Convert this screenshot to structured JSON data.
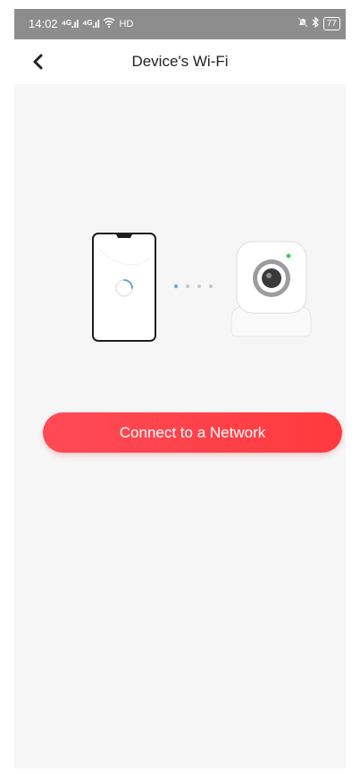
{
  "status_bar": {
    "time": "14:02",
    "signal_1": "⁴ᴳ.ıl",
    "signal_2": "⁴ᴳ.ıl",
    "wifi_label": "HD",
    "battery": "77"
  },
  "header": {
    "title": "Device's Wi-Fi",
    "back_icon": "chevron-left-icon"
  },
  "illustration": {
    "phone_icon": "smartphone-icon",
    "spinner_icon": "loading-spinner-icon",
    "dots_icon": "connecting-dots-icon",
    "camera_icon": "camera-device-icon"
  },
  "main": {
    "connect_label": "Connect to a Network"
  },
  "colors": {
    "accent": "#ff3f47",
    "background": "#f6f6f6",
    "status_bar": "#8d8d8d",
    "camera_led": "#3ad24a",
    "dot_active": "#6fa6e0",
    "dot_inactive": "#c8c8c8"
  }
}
